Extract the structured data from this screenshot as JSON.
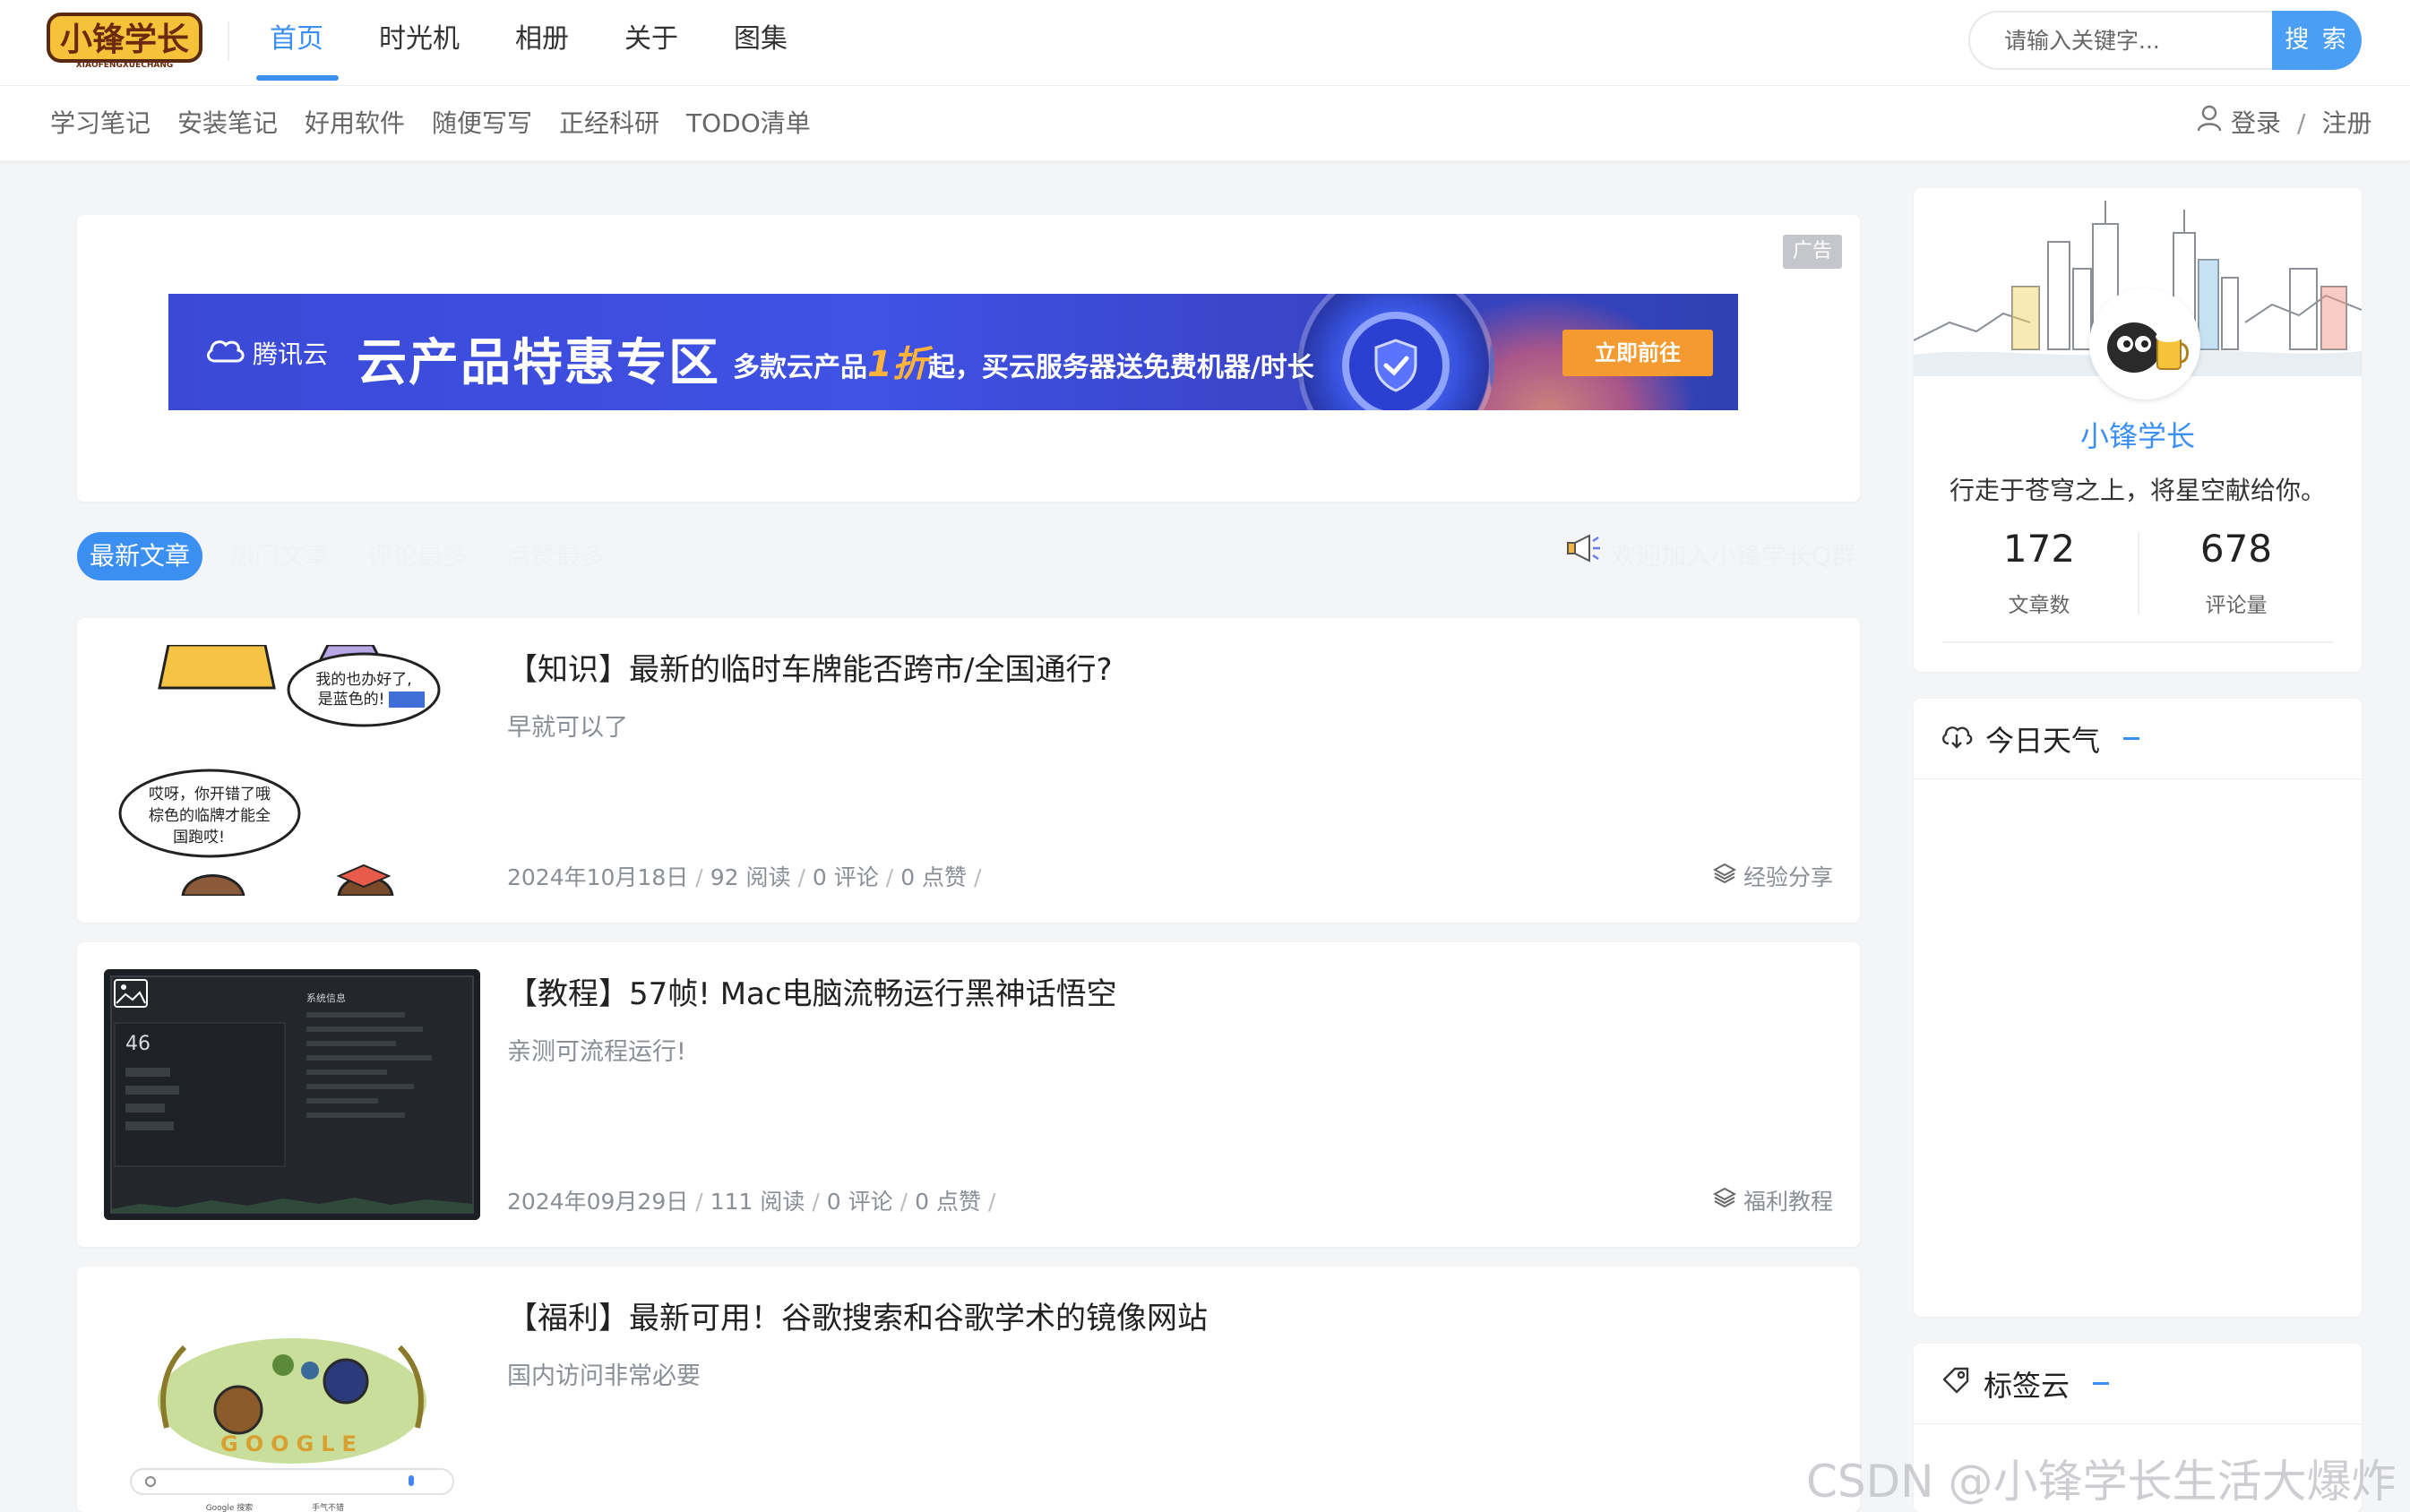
{
  "site": {
    "logo_text": "小锋学长",
    "logo_sub": "XIAOFENGXUECHANG"
  },
  "nav": {
    "items": [
      {
        "label": "首页",
        "active": true
      },
      {
        "label": "时光机",
        "active": false
      },
      {
        "label": "相册",
        "active": false
      },
      {
        "label": "关于",
        "active": false
      },
      {
        "label": "图集",
        "active": false
      }
    ]
  },
  "search": {
    "placeholder": "请输入关键字...",
    "button_label": "搜 索"
  },
  "subnav": {
    "items": [
      "学习笔记",
      "安装笔记",
      "好用软件",
      "随便写写",
      "正经科研",
      "TODO清单"
    ],
    "login_label": "登录",
    "register_label": "注册",
    "login_separator": "/"
  },
  "ad": {
    "tag": "广告",
    "brand": "腾讯云",
    "title": "云产品特惠专区",
    "subtitle_pre": "多款云产品",
    "subtitle_highlight": "1折",
    "subtitle_post": "起，买云服务器送免费机器/时长",
    "cta": "立即前往"
  },
  "tabs": {
    "active": "最新文章",
    "others": [
      "热门文章",
      "评论最多",
      "点赞最多"
    ],
    "notice": "欢迎加入小锋学长Q群"
  },
  "articles": [
    {
      "title": "【知识】最新的临时车牌能否跨市/全国通行?",
      "summary": "早就可以了",
      "date": "2024年10月18日",
      "reads": "92 阅读",
      "comments": "0 评论",
      "likes": "0 点赞",
      "category": "经验分享",
      "thumb_text_1": "我的也办好了,",
      "thumb_text_2": "是蓝色的!",
      "thumb_text_3": "哎呀，你开错了哦",
      "thumb_text_4": "棕色的临牌才能全",
      "thumb_text_5": "国跑哎!"
    },
    {
      "title": "【教程】57帧! Mac电脑流畅运行黑神话悟空",
      "summary": "亲测可流程运行!",
      "date": "2024年09月29日",
      "reads": "111 阅读",
      "comments": "0 评论",
      "likes": "0 点赞",
      "category": "福利教程",
      "thumb_fps": "46",
      "thumb_label": "系统信息"
    },
    {
      "title": "【福利】最新可用！谷歌搜索和谷歌学术的镜像网站",
      "summary": "国内访问非常必要",
      "thumb_logo": "GOOGLE",
      "thumb_btn_1": "Google 搜索",
      "thumb_btn_2": "手气不错"
    }
  ],
  "meta_separator": "/",
  "profile": {
    "name": "小锋学长",
    "motto": "行走于苍穹之上，将星空献给你。",
    "stats": [
      {
        "value": "172",
        "label": "文章数"
      },
      {
        "value": "678",
        "label": "评论量"
      }
    ]
  },
  "widgets": {
    "weather_title": "今日天气",
    "tags_title": "标签云"
  },
  "watermark": "CSDN @小锋学长生活大爆炸",
  "colors": {
    "accent": "#3b8ff0",
    "page_bg": "#f4f5f7",
    "ad_blue": "#3f52e4",
    "ad_orange": "#f39a31"
  }
}
